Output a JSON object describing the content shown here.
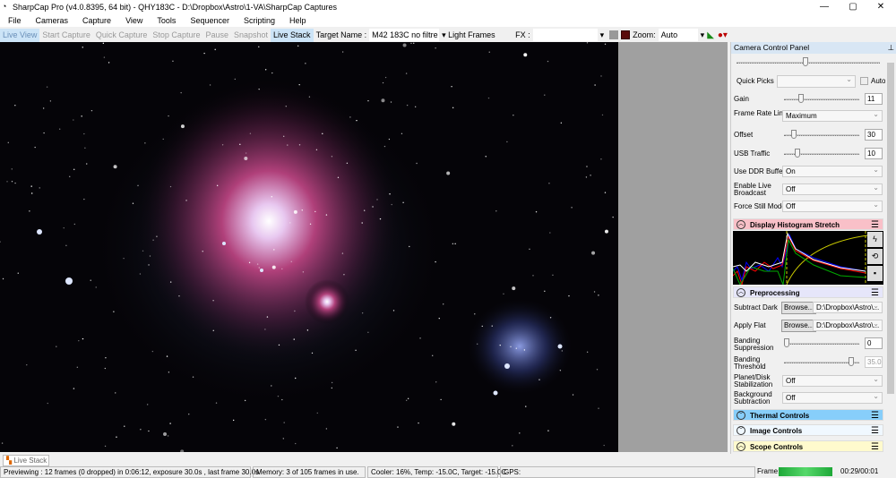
{
  "window": {
    "title": "SharpCap Pro (v4.0.8395, 64 bit) - QHY183C - D:\\Dropbox\\Astro\\1-VA\\SharpCap Captures"
  },
  "menu": [
    "File",
    "Cameras",
    "Capture",
    "View",
    "Tools",
    "Sequencer",
    "Scripting",
    "Help"
  ],
  "toolbar": {
    "live_view": "Live View",
    "start_capture": "Start Capture",
    "quick_capture": "Quick Capture",
    "stop_capture": "Stop Capture",
    "pause": "Pause",
    "snapshot": "Snapshot",
    "live_stack": "Live Stack",
    "target_label": "Target Name :",
    "target_value": "M42 183C no filtre",
    "frame_type": "Light Frames",
    "fx_label": "FX :",
    "fx_value": "",
    "zoom_label": "Zoom:",
    "zoom_value": "Auto"
  },
  "panel": {
    "title": "Camera Control Panel",
    "quick_picks": "Quick Picks",
    "auto": "Auto",
    "gain": {
      "label": "Gain",
      "value": "11"
    },
    "frame_rate": {
      "label": "Frame Rate Limit",
      "value": "Maximum"
    },
    "offset": {
      "label": "Offset",
      "value": "30"
    },
    "usb": {
      "label": "USB Traffic",
      "value": "10"
    },
    "ddr": {
      "label": "Use DDR Buffer",
      "value": "On"
    },
    "broadcast": {
      "label": "Enable Live Broadcast",
      "value": "Off"
    },
    "still": {
      "label": "Force Still Mode",
      "value": "Off"
    },
    "histogram": "Display Histogram Stretch",
    "preprocessing": "Preprocessing",
    "dark": {
      "label": "Subtract Dark",
      "button": "Browse...",
      "value": "D:\\Dropbox\\Astro\\..."
    },
    "flat": {
      "label": "Apply Flat",
      "button": "Browse...",
      "value": "D:\\Dropbox\\Astro\\..."
    },
    "banding_sup": {
      "label": "Banding Suppression",
      "value": "0"
    },
    "banding_thr": {
      "label": "Banding Threshold",
      "value": "35.0"
    },
    "planet": {
      "label": "Planet/Disk Stabilization",
      "value": "Off"
    },
    "background": {
      "label": "Background Subtraction",
      "value": "Off"
    },
    "thermal": "Thermal Controls",
    "image": "Image Controls",
    "scope": "Scope Controls",
    "colors": {
      "histogram": "#f9c0c8",
      "preprocessing": "#e6e6fa",
      "thermal": "#87cefa",
      "image": "#f0f8ff",
      "scope": "#fffacd"
    }
  },
  "tab": "Live Stack",
  "status": {
    "preview": "Previewing : 12 frames (0 dropped) in 0:06:12, exposure 30.0s , last frame 30.0s",
    "memory": "Memory: 3 of 105 frames in use.",
    "cooler": "Cooler: 16%, Temp: -15.0C, Target: -15.0C",
    "gps": "GPS:",
    "frame_label": "Frame:",
    "frame_progress": 1.0,
    "time": "00:29/00:01"
  }
}
